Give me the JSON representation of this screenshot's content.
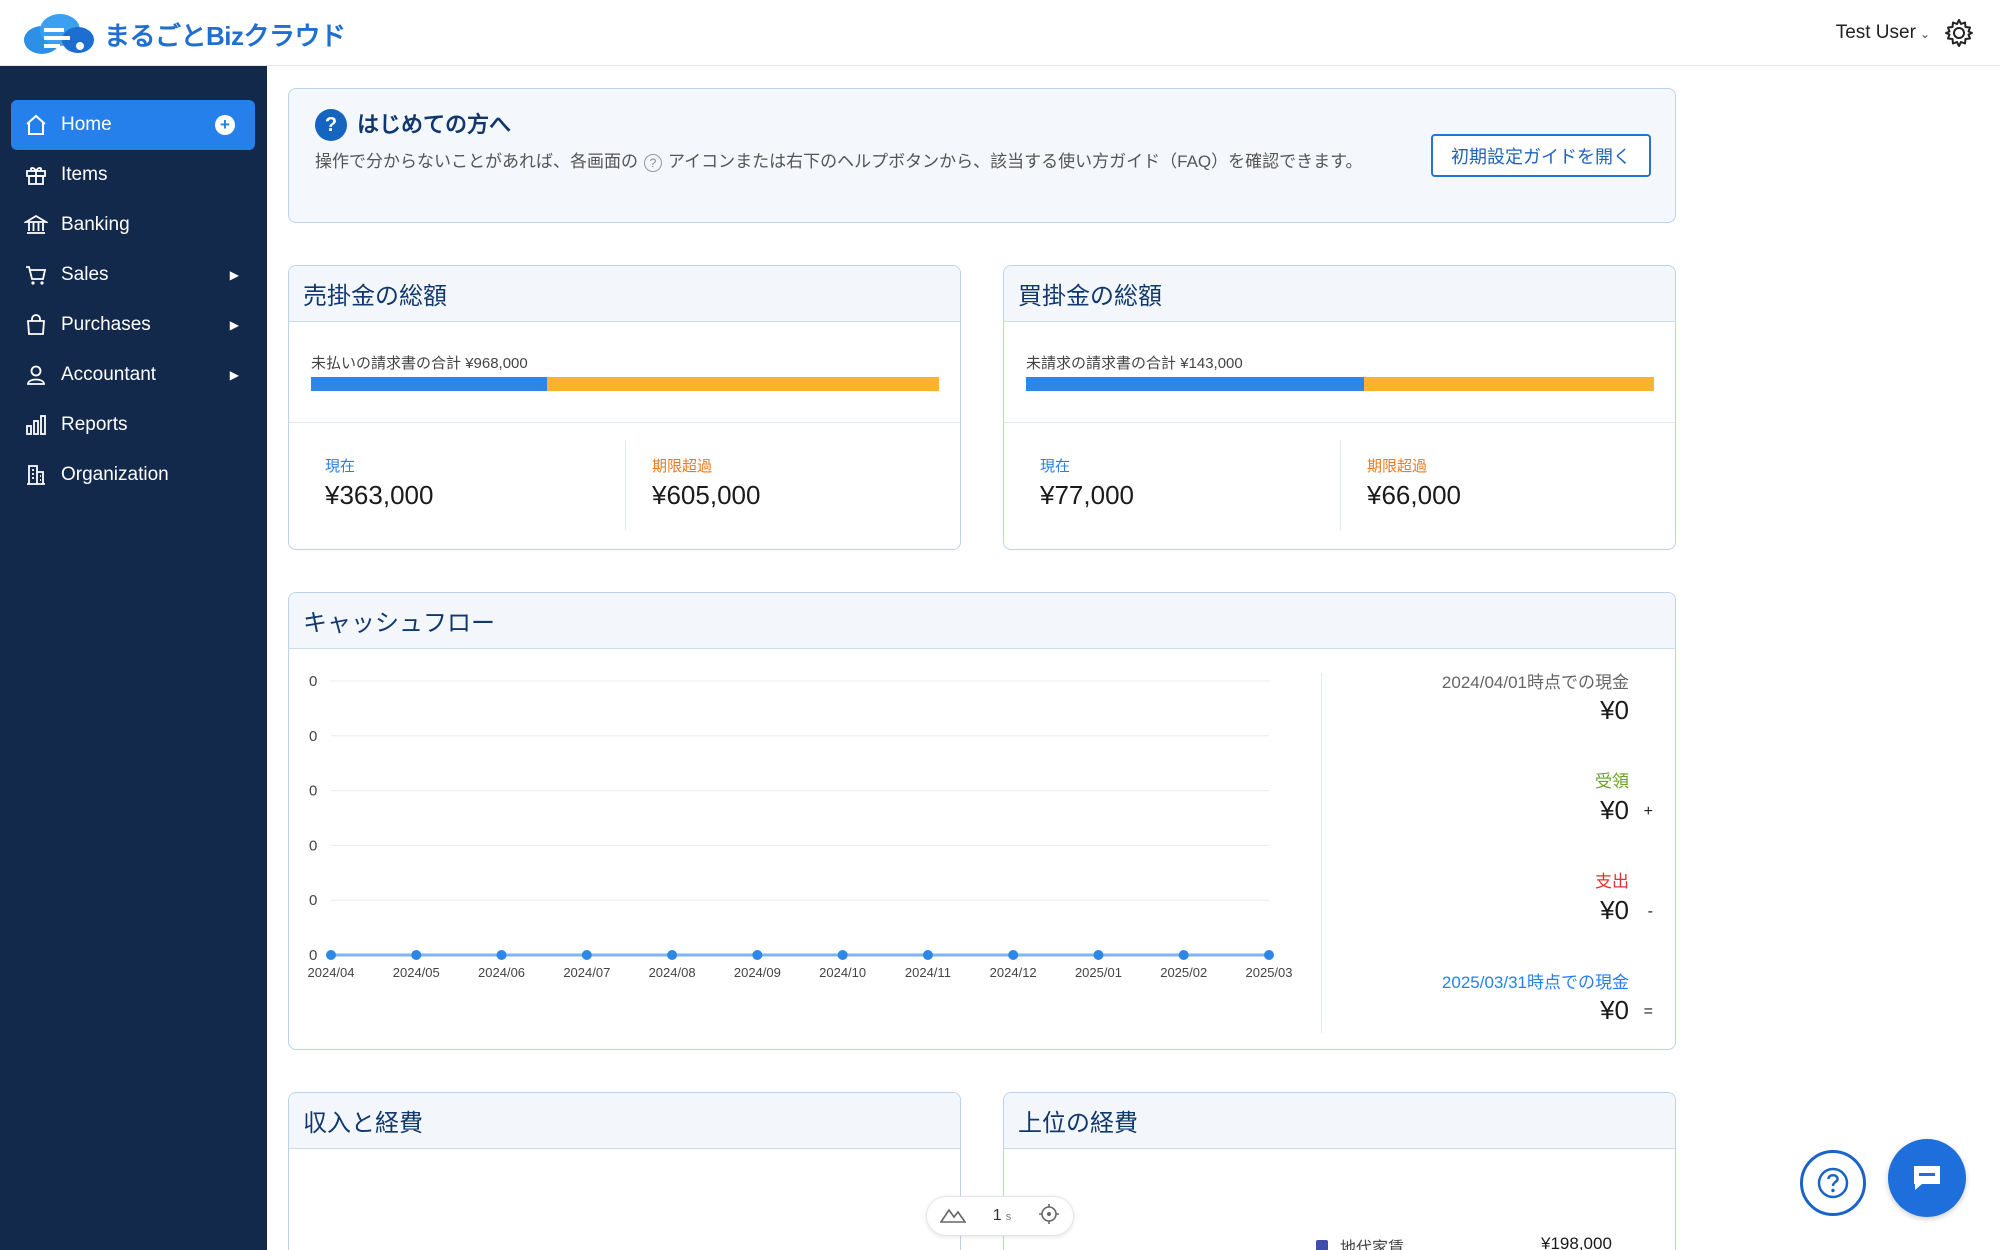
{
  "header": {
    "logo_text": "まるごとBizクラウド",
    "user_name": "Test User"
  },
  "sidebar": {
    "items": [
      {
        "label": "Home",
        "icon": "home-icon",
        "active": true
      },
      {
        "label": "Items",
        "icon": "gift-icon"
      },
      {
        "label": "Banking",
        "icon": "bank-icon"
      },
      {
        "label": "Sales",
        "icon": "cart-icon",
        "has_submenu": true
      },
      {
        "label": "Purchases",
        "icon": "bag-icon",
        "has_submenu": true
      },
      {
        "label": "Accountant",
        "icon": "person-icon",
        "has_submenu": true
      },
      {
        "label": "Reports",
        "icon": "bar-chart-icon"
      },
      {
        "label": "Organization",
        "icon": "building-icon"
      }
    ]
  },
  "welcome": {
    "title": "はじめての方へ",
    "text_before_icon": "操作で分からないことがあれば、各画面の",
    "text_after_icon": "アイコンまたは右下のヘルプボタンから、該当する使い方ガイド（FAQ）を確認できます。",
    "guide_button": "初期設定ガイドを開く"
  },
  "receivables": {
    "title": "売掛金の総額",
    "total_label": "未払いの請求書の合計 ¥968,000",
    "current_label": "現在",
    "current_value": "¥363,000",
    "overdue_label": "期限超過",
    "overdue_value": "¥605,000",
    "current_fraction": 0.375
  },
  "payables": {
    "title": "買掛金の総額",
    "total_label": "未請求の請求書の合計 ¥143,000",
    "current_label": "現在",
    "current_value": "¥77,000",
    "overdue_label": "期限超過",
    "overdue_value": "¥66,000",
    "current_fraction": 0.538
  },
  "cashflow": {
    "title": "キャッシュフロー",
    "opening_label": "2024/04/01時点での現金",
    "opening_value": "¥0",
    "received_label": "受領",
    "received_value": "¥0",
    "received_op": "+",
    "spent_label": "支出",
    "spent_value": "¥0",
    "spent_op": "-",
    "closing_label": "2025/03/31時点での現金",
    "closing_value": "¥0",
    "closing_op": "="
  },
  "chart_data": {
    "type": "line",
    "title": "",
    "xlabel": "",
    "ylabel": "",
    "categories": [
      "2024/04",
      "2024/05",
      "2024/06",
      "2024/07",
      "2024/08",
      "2024/09",
      "2024/10",
      "2024/11",
      "2024/12",
      "2025/01",
      "2025/02",
      "2025/03"
    ],
    "y_tick_labels": [
      "0",
      "0",
      "0",
      "0",
      "0",
      "0"
    ],
    "series": [
      {
        "values": [
          0,
          0,
          0,
          0,
          0,
          0,
          0,
          0,
          0,
          0,
          0,
          0
        ],
        "color": "#2d87e8"
      }
    ],
    "grid": true
  },
  "income_expense": {
    "title": "収入と経費"
  },
  "top_expenses": {
    "title": "上位の経費",
    "items": [
      {
        "label": "地代家賃",
        "value": "¥198,000",
        "color": "#3f4ea8"
      }
    ]
  },
  "mini_toolbar": {
    "value": "1",
    "unit": "s"
  }
}
